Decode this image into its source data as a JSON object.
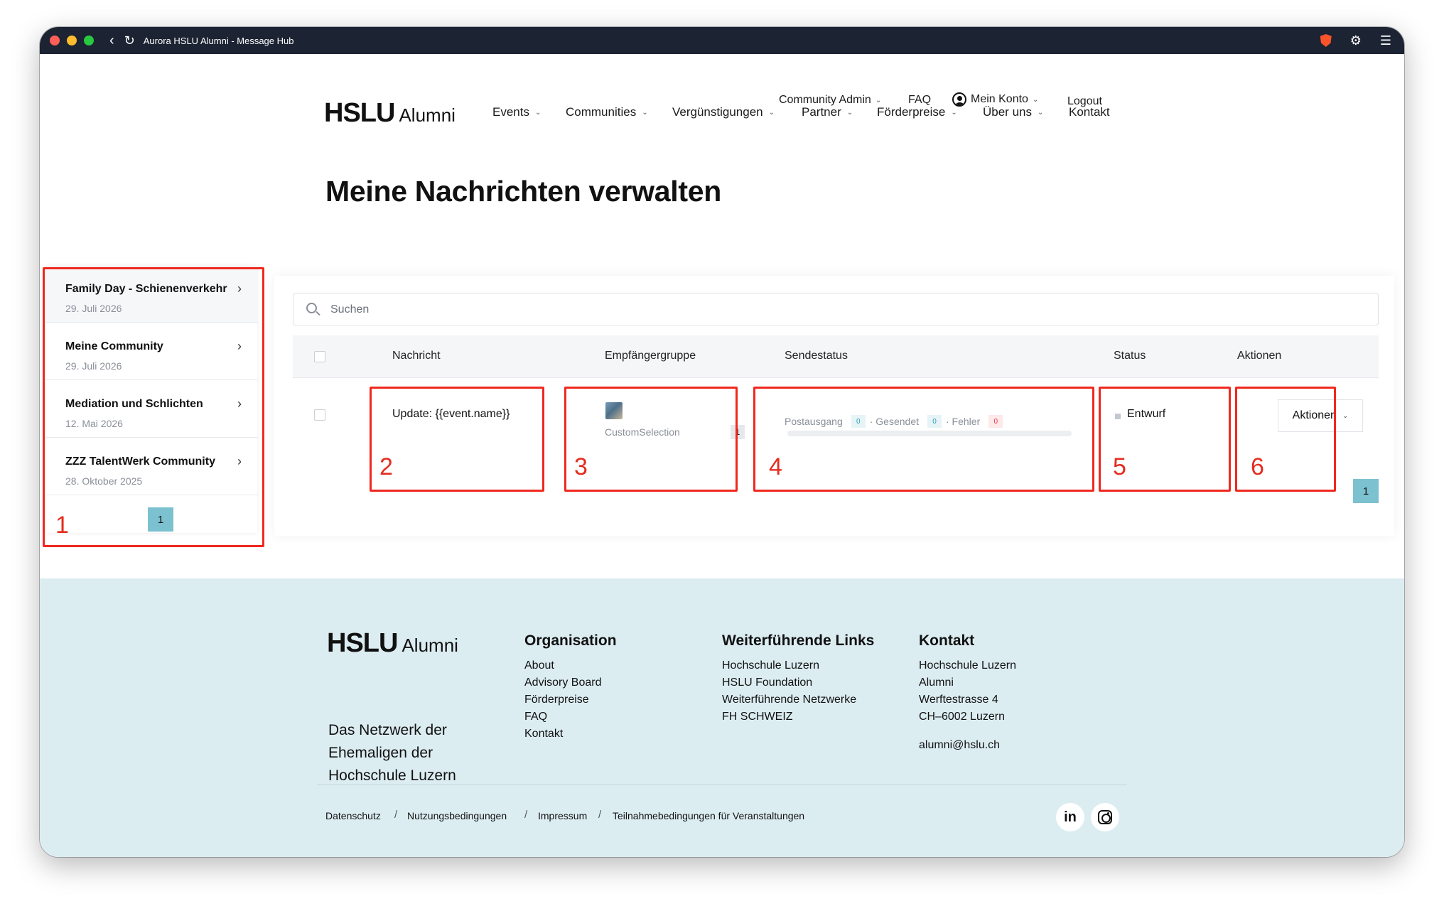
{
  "window": {
    "title": "Aurora HSLU Alumni - Message Hub"
  },
  "header": {
    "topnav": {
      "community_admin": "Community Admin",
      "faq": "FAQ",
      "account": "Mein Konto",
      "logout": "Logout"
    },
    "logo": {
      "strong": "HSLU",
      "light": "Alumni"
    },
    "mainnav": [
      "Events",
      "Communities",
      "Vergünstigungen",
      "Partner",
      "Förderpreise",
      "Über uns",
      "Kontakt"
    ]
  },
  "page": {
    "title": "Meine Nachrichten verwalten"
  },
  "conversations": {
    "items": [
      {
        "name": "Family Day - Schienenverkehr",
        "date": "29. Juli 2026"
      },
      {
        "name": "Meine Community",
        "date": "29. Juli 2026"
      },
      {
        "name": "Mediation und Schlichten",
        "date": "12. Mai 2026"
      },
      {
        "name": "ZZZ TalentWerk Community",
        "date": "28. Oktober 2025"
      }
    ],
    "page": "1"
  },
  "search": {
    "placeholder": "Suchen"
  },
  "table": {
    "columns": [
      "Nachricht",
      "Empfängergruppe",
      "Sendestatus",
      "Status",
      "Aktionen"
    ],
    "rows": [
      {
        "message": "Update: {{event.name}}",
        "recipient_group": "CustomSelection",
        "recipient_count": "1",
        "send_status": {
          "outbox_label": "Postausgang",
          "outbox": "0",
          "sent_label": "· Gesendet",
          "sent": "0",
          "error_label": "· Fehler",
          "error": "0"
        },
        "status": "Entwurf",
        "actions_label": "Aktionen"
      }
    ],
    "page": "1"
  },
  "annotations": [
    "1",
    "2",
    "3",
    "4",
    "5",
    "6"
  ],
  "footer": {
    "logo": {
      "strong": "HSLU",
      "light": "Alumni"
    },
    "tagline": "Das Netzwerk der Ehemaligen der Hochschule Luzern",
    "organisation": {
      "title": "Organisation",
      "links": [
        "About",
        "Advisory Board",
        "Förderpreise",
        "FAQ",
        "Kontakt"
      ]
    },
    "links": {
      "title": "Weiterführende Links",
      "links": [
        "Hochschule Luzern",
        "HSLU Foundation",
        "Weiterführende Netzwerke",
        "FH SCHWEIZ"
      ]
    },
    "contact": {
      "title": "Kontakt",
      "lines": [
        "Hochschule Luzern",
        "Alumni",
        "Werftestrasse 4",
        "CH–6002 Luzern"
      ],
      "email": "alumni@hslu.ch"
    },
    "legal": [
      "Datenschutz",
      "Nutzungsbedingungen",
      "Impressum",
      "Teilnahmebedingungen für Veranstaltungen"
    ],
    "separator": "/",
    "social": {
      "linkedin": "in"
    }
  },
  "colors": {
    "accent": "#7cc1cf",
    "titlebar": "#1c2333",
    "footer_bg": "#dcedf2",
    "annotation": "#f0281e"
  }
}
